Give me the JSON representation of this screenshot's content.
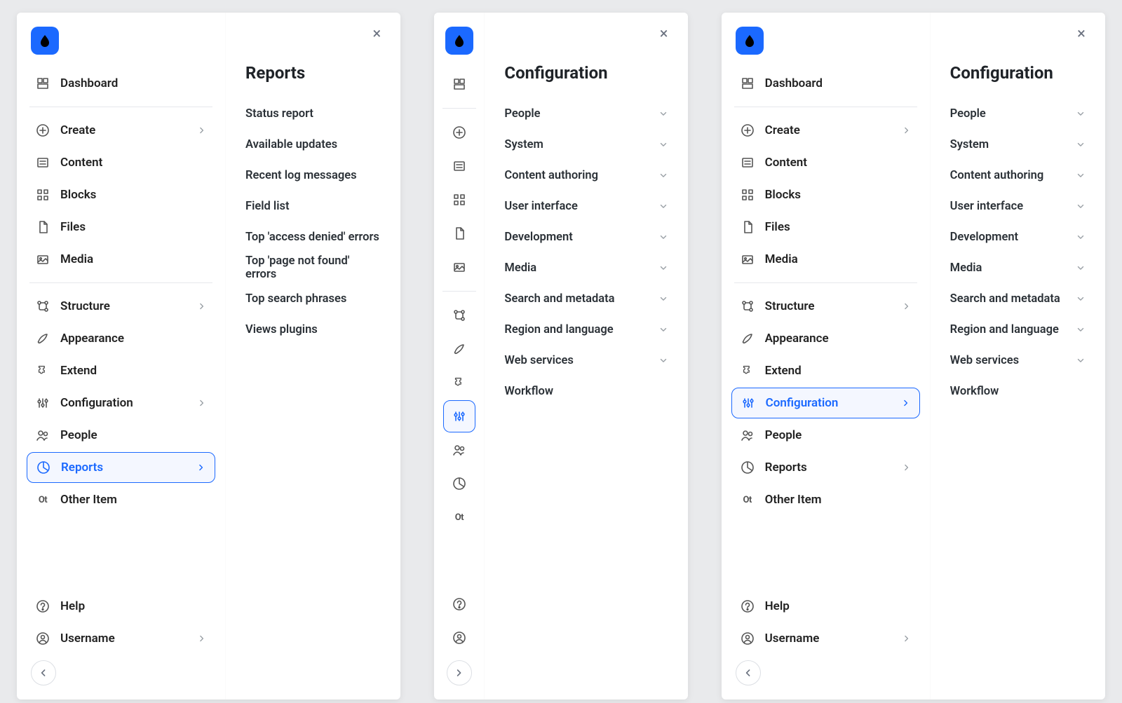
{
  "brand": {
    "logo_color": "#1b69ff"
  },
  "sidebar": {
    "dashboard": "Dashboard",
    "create": "Create",
    "content": "Content",
    "blocks": "Blocks",
    "files": "Files",
    "media": "Media",
    "structure": "Structure",
    "appearance": "Appearance",
    "extend": "Extend",
    "configuration": "Configuration",
    "people": "People",
    "reports": "Reports",
    "other_item": "Other Item",
    "help": "Help",
    "username": "Username"
  },
  "panel1": {
    "active_item": "reports",
    "flyout_title": "Reports",
    "items": [
      "Status report",
      "Available updates",
      "Recent log messages",
      "Field list",
      "Top 'access denied' errors",
      "Top 'page not found' errors",
      "Top search phrases",
      "Views plugins"
    ]
  },
  "panel2": {
    "active_item": "configuration",
    "flyout_title": "Configuration",
    "items": [
      {
        "label": "People",
        "expandable": true
      },
      {
        "label": "System",
        "expandable": true
      },
      {
        "label": "Content authoring",
        "expandable": true
      },
      {
        "label": "User interface",
        "expandable": true
      },
      {
        "label": "Development",
        "expandable": true
      },
      {
        "label": "Media",
        "expandable": true
      },
      {
        "label": "Search and metadata",
        "expandable": true
      },
      {
        "label": "Region and language",
        "expandable": true
      },
      {
        "label": "Web services",
        "expandable": true
      },
      {
        "label": "Workflow",
        "expandable": false
      }
    ]
  },
  "panel3": {
    "active_item": "configuration",
    "flyout_title": "Configuration",
    "items": [
      {
        "label": "People",
        "expandable": true
      },
      {
        "label": "System",
        "expandable": true
      },
      {
        "label": "Content authoring",
        "expandable": true
      },
      {
        "label": "User interface",
        "expandable": true
      },
      {
        "label": "Development",
        "expandable": true
      },
      {
        "label": "Media",
        "expandable": true
      },
      {
        "label": "Search and metadata",
        "expandable": true
      },
      {
        "label": "Region and language",
        "expandable": true
      },
      {
        "label": "Web services",
        "expandable": true
      },
      {
        "label": "Workflow",
        "expandable": false
      }
    ]
  }
}
